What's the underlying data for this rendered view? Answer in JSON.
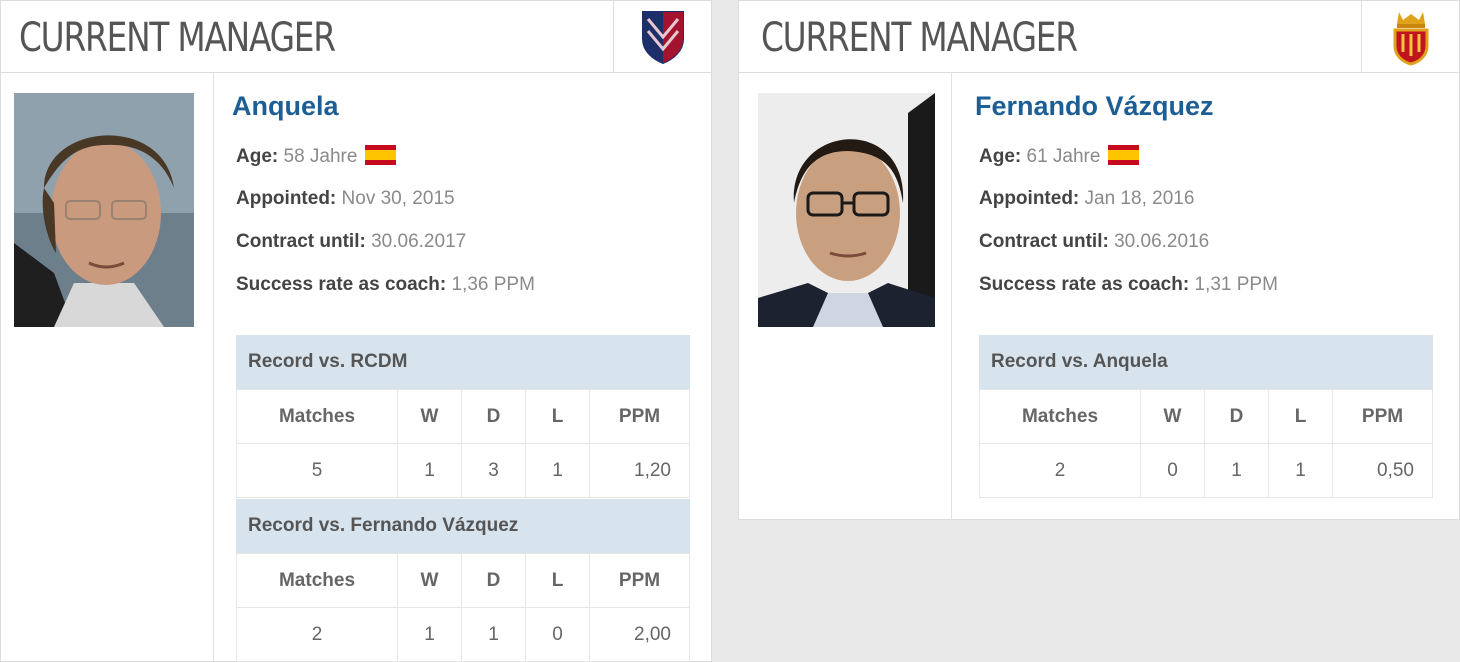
{
  "left": {
    "header": {
      "title": "CURRENT MANAGER",
      "crest": "club-crest-icon"
    },
    "manager": {
      "name": "Anquela",
      "age_label": "Age:",
      "age": "58 Jahre",
      "appointed_label": "Appointed:",
      "appointed": "Nov 30, 2015",
      "contract_label": "Contract until:",
      "contract": "30.06.2017",
      "success_label": "Success rate as coach:",
      "success": "1,36 PPM"
    },
    "records": [
      {
        "title": "Record vs. RCDM",
        "columns": [
          "Matches",
          "W",
          "D",
          "L",
          "PPM"
        ],
        "values": [
          "5",
          "1",
          "3",
          "1",
          "1,20"
        ]
      },
      {
        "title": "Record vs. Fernando Vázquez",
        "columns": [
          "Matches",
          "W",
          "D",
          "L",
          "PPM"
        ],
        "values": [
          "2",
          "1",
          "1",
          "0",
          "2,00"
        ]
      }
    ]
  },
  "right": {
    "header": {
      "title": "CURRENT MANAGER",
      "crest": "club-crest-icon"
    },
    "manager": {
      "name": "Fernando Vázquez",
      "age_label": "Age:",
      "age": "61 Jahre",
      "appointed_label": "Appointed:",
      "appointed": "Jan 18, 2016",
      "contract_label": "Contract until:",
      "contract": "30.06.2016",
      "success_label": "Success rate as coach:",
      "success": "1,31 PPM"
    },
    "records": [
      {
        "title": "Record vs. Anquela",
        "columns": [
          "Matches",
          "W",
          "D",
          "L",
          "PPM"
        ],
        "values": [
          "2",
          "0",
          "1",
          "1",
          "0,50"
        ]
      }
    ]
  },
  "colors": {
    "name": "#1d5f95",
    "record_header_bg": "#d7e4ed",
    "page_bg": "#e9e9e9"
  }
}
